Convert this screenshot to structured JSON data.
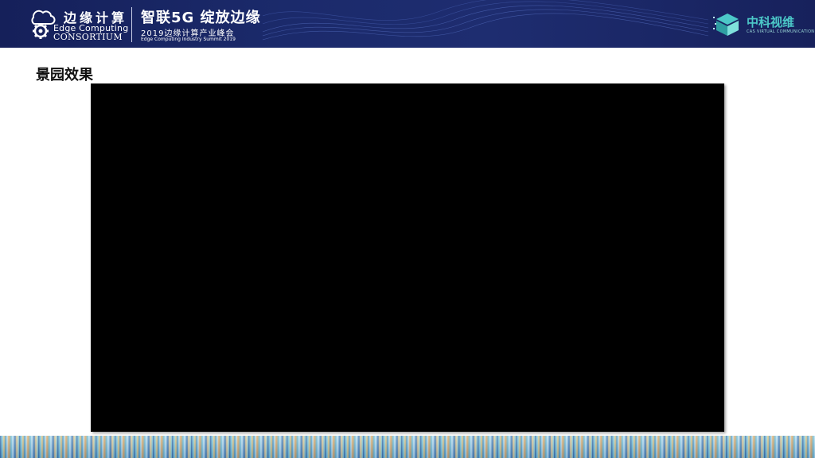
{
  "header": {
    "org_name_cn": "边缘计算",
    "org_name_en_line1": "Edge Computing",
    "org_name_en_line2": "CONSORTIUM",
    "slogan": "智联5G  绽放边缘",
    "summit_cn": "2019边缘计算产业峰会",
    "summit_en": "Edge Computing Industry Summit 2019",
    "partner_name_cn": "中科视维",
    "partner_name_en": "CAS VIRTUAL COMMUNICATION"
  },
  "main": {
    "section_title": "景园效果"
  },
  "colors": {
    "banner": "#1b2a6b",
    "partner_accent": "#4cc8c8",
    "video_background": "#000000"
  },
  "icons": {
    "org_logo": "edge-computing-gear-cloud-icon",
    "partner_logo": "zhongke-shiwei-cube-icon"
  }
}
